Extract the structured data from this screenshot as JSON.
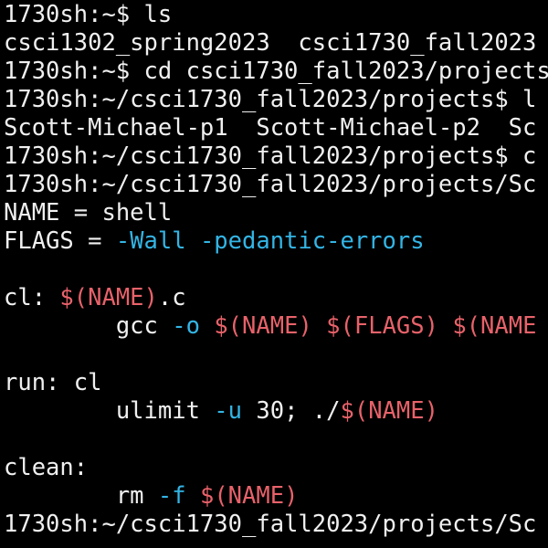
{
  "colors": {
    "background": "#000000",
    "text": "#f0f0f0",
    "flag": "#33b5e5",
    "variable": "#e8626a"
  },
  "terminal": {
    "l1": {
      "prompt": "1730sh:~$ ",
      "command": "ls"
    },
    "l2": {
      "text": "csci1302_spring2023  csci1730_fall2023"
    },
    "l3": {
      "prompt": "1730sh:~$ ",
      "command": "cd csci1730_fall2023/projects"
    },
    "l4": {
      "prompt": "1730sh:~/csci1730_fall2023/projects$ ",
      "command": "l"
    },
    "l5": {
      "text": "Scott-Michael-p1  Scott-Michael-p2  Sc"
    },
    "l6": {
      "prompt": "1730sh:~/csci1730_fall2023/projects$ ",
      "command": "c"
    },
    "l7": {
      "prompt": "1730sh:~/csci1730_fall2023/projects/Sc"
    },
    "l8": {
      "text": "NAME = shell"
    },
    "l9": {
      "prefix": "FLAGS = ",
      "flags": "-Wall -pedantic-errors"
    },
    "l11": {
      "target": "cl: ",
      "var": "$(NAME)",
      "suffix": ".c"
    },
    "l12": {
      "indent": "        ",
      "cmd": "gcc ",
      "flag": "-o",
      "sp1": " ",
      "var1": "$(NAME)",
      "sp2": " ",
      "var2": "$(FLAGS)",
      "sp3": " ",
      "var3": "$(NAME"
    },
    "l14": {
      "text": "run: cl"
    },
    "l15": {
      "indent": "        ",
      "cmd": "ulimit ",
      "flag": "-u",
      "mid": " 30; ./",
      "var": "$(NAME)"
    },
    "l17": {
      "text": "clean:"
    },
    "l18": {
      "indent": "        ",
      "cmd": "rm ",
      "flag": "-f",
      "sp": " ",
      "var": "$(NAME)"
    },
    "l19": {
      "prompt": "1730sh:~/csci1730_fall2023/projects/Sc"
    }
  }
}
